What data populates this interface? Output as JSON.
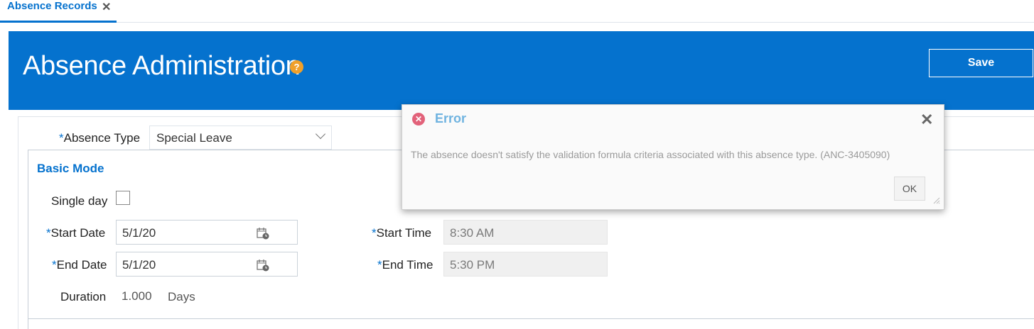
{
  "tabs": [
    {
      "label": "Absence Records",
      "close_glyph": "✕"
    }
  ],
  "header": {
    "title": "Absence Administration",
    "help_glyph": "?",
    "save_label": "Save",
    "background": "#0572ce"
  },
  "form": {
    "absence_type": {
      "required_mark": "*",
      "label": "Absence Type",
      "value": "Special Leave"
    },
    "section_title": "Basic Mode",
    "single_day": {
      "label": "Single day",
      "checked": false
    },
    "start_date": {
      "required_mark": "*",
      "label": "Start Date",
      "value": "5/1/20"
    },
    "end_date": {
      "required_mark": "*",
      "label": "End Date",
      "value": "5/1/20"
    },
    "start_time": {
      "required_mark": "*",
      "label": "Start Time",
      "value": "8:30 AM"
    },
    "end_time": {
      "required_mark": "*",
      "label": "End Time",
      "value": "5:30 PM"
    },
    "duration": {
      "label": "Duration",
      "value": "1.000",
      "unit": "Days"
    }
  },
  "dialog": {
    "title": "Error",
    "icon_glyph": "✕",
    "close_glyph": "✕",
    "message": "The absence doesn't satisfy the validation formula criteria associated with this absence type. (ANC-3405090)",
    "ok_label": "OK",
    "error_color": "#e2627a",
    "title_color": "#6fb3e0"
  }
}
